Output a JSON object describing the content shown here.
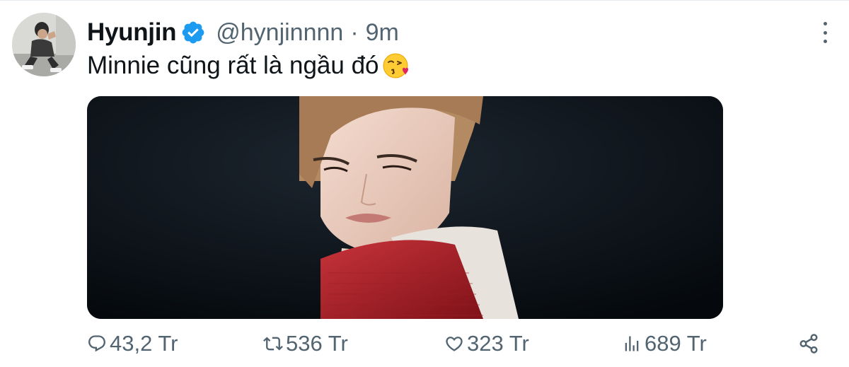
{
  "author": {
    "display_name": "Hyunjin",
    "handle": "@hynjinnnn",
    "separator": "·",
    "time": "9m",
    "verified": true,
    "verified_color": "#1d9bf0"
  },
  "tweet": {
    "text": "Minnie cũng rất là ngầu đó",
    "emoji": "face-blowing-a-kiss"
  },
  "icons": {
    "more": "more-vertical-icon",
    "reply": "reply-icon",
    "retweet": "retweet-icon",
    "like": "heart-icon",
    "views": "views-icon",
    "share": "share-icon"
  },
  "stats": {
    "replies": "43,2 Tr",
    "retweets": "536 Tr",
    "likes": "323 Tr",
    "views": "689 Tr"
  },
  "colors": {
    "text_primary": "#0f1419",
    "text_secondary": "#536471",
    "accent": "#1d9bf0"
  }
}
